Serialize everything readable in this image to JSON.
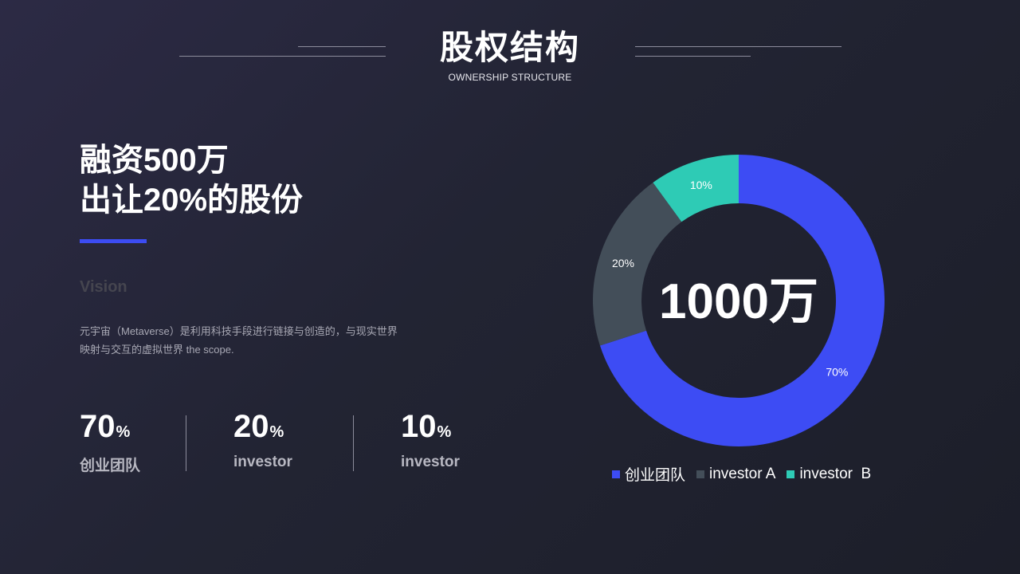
{
  "header": {
    "title": "股权结构",
    "subtitle": "OWNERSHIP STRUCTURE"
  },
  "left": {
    "headline_line1": "融资500万",
    "headline_line2": "出让20%的股份",
    "vision_label": "Vision",
    "description_line1": "元宇宙（Metaverse）是利用科技手段进行链接与创造的，与现实世界",
    "description_line2": "映射与交互的虚拟世界 the scope."
  },
  "stats": [
    {
      "value": "70",
      "unit": "%",
      "label": "创业团队"
    },
    {
      "value": "20",
      "unit": "%",
      "label": "investor"
    },
    {
      "value": "10",
      "unit": "%",
      "label": "investor"
    }
  ],
  "chart_data": {
    "type": "pie",
    "variant": "donut",
    "center_label": "1000万",
    "categories": [
      "创业团队",
      "investor A",
      "investor  B"
    ],
    "values": [
      70,
      20,
      10
    ],
    "data_labels": [
      "70%",
      "20%",
      "10%"
    ],
    "colors": [
      "#3d4cf4",
      "#434e59",
      "#2ecbb5"
    ],
    "legend_position": "bottom"
  },
  "colors": {
    "accent": "#3c4cf2",
    "background": "#23253a"
  }
}
